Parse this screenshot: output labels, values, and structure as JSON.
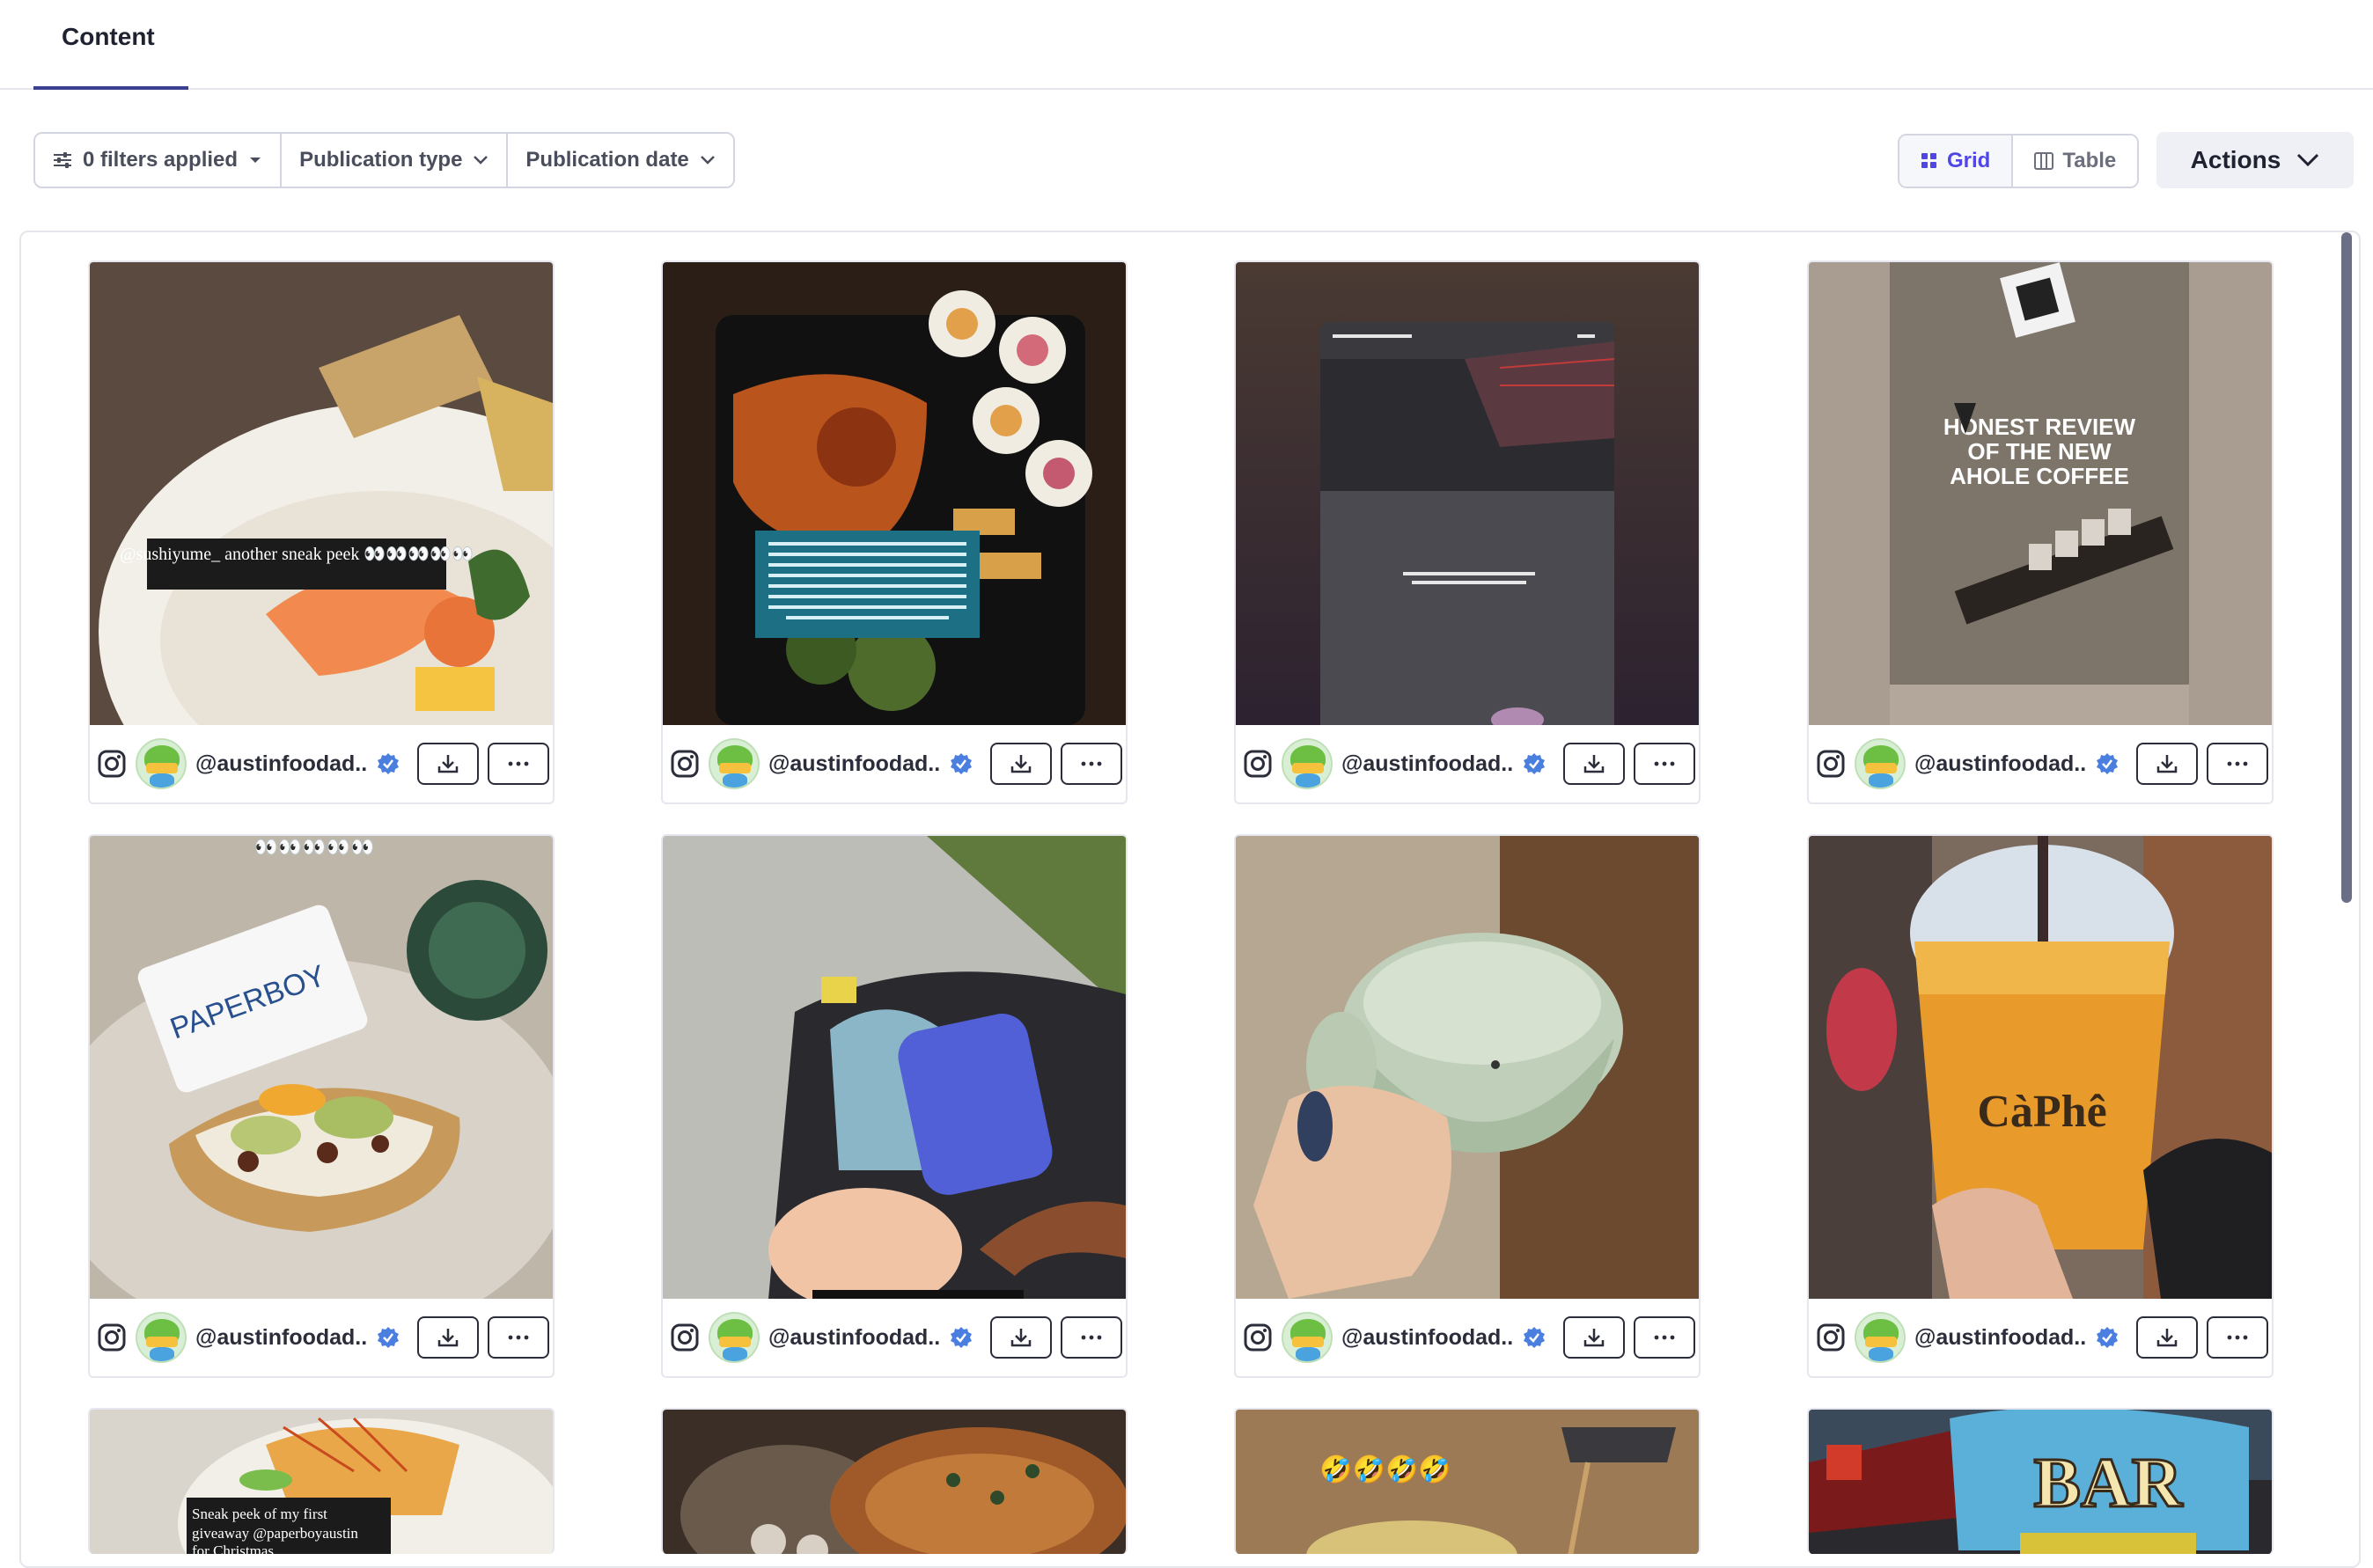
{
  "header": {
    "tab_label": "Content"
  },
  "filters": {
    "filters_applied": "0 filters applied",
    "publication_type": "Publication type",
    "publication_date": "Publication date"
  },
  "view": {
    "grid_label": "Grid",
    "table_label": "Table",
    "active": "grid"
  },
  "actions_label": "Actions",
  "cards": [
    {
      "handle": "@austinfoodad...",
      "platform": "instagram-icon",
      "thumb_text": "@sushiyume_ another sneak peek 👀👀👀👀👀"
    },
    {
      "handle": "@austinfoodad...",
      "platform": "instagram-icon",
      "thumb_text": ""
    },
    {
      "handle": "@austinfoodad...",
      "platform": "instagram-icon",
      "thumb_text": ""
    },
    {
      "handle": "@austinfoodad...",
      "platform": "instagram-icon",
      "thumb_text": "HONEST REVIEW OF THE NEW AHOLE COFFEE"
    },
    {
      "handle": "@austinfoodad...",
      "platform": "instagram-icon",
      "thumb_text": "PAPERBOY"
    },
    {
      "handle": "@austinfoodad...",
      "platform": "instagram-icon",
      "thumb_text": ""
    },
    {
      "handle": "@austinfoodad...",
      "platform": "instagram-icon",
      "thumb_text": ""
    },
    {
      "handle": "@austinfoodad...",
      "platform": "instagram-icon",
      "thumb_text": "CàPhê"
    },
    {
      "handle": "",
      "platform": "",
      "thumb_text": "Sneak peek of my first giveaway @paperboyaustin for Christmas"
    },
    {
      "handle": "",
      "platform": "",
      "thumb_text": ""
    },
    {
      "handle": "",
      "platform": "",
      "thumb_text": "🤣🤣🤣🤣"
    },
    {
      "handle": "",
      "platform": "",
      "thumb_text": "BAR"
    }
  ],
  "colors": {
    "accent": "#4f46e5",
    "tab_underline": "#3b3f8f",
    "verified": "#4a7fe0"
  }
}
